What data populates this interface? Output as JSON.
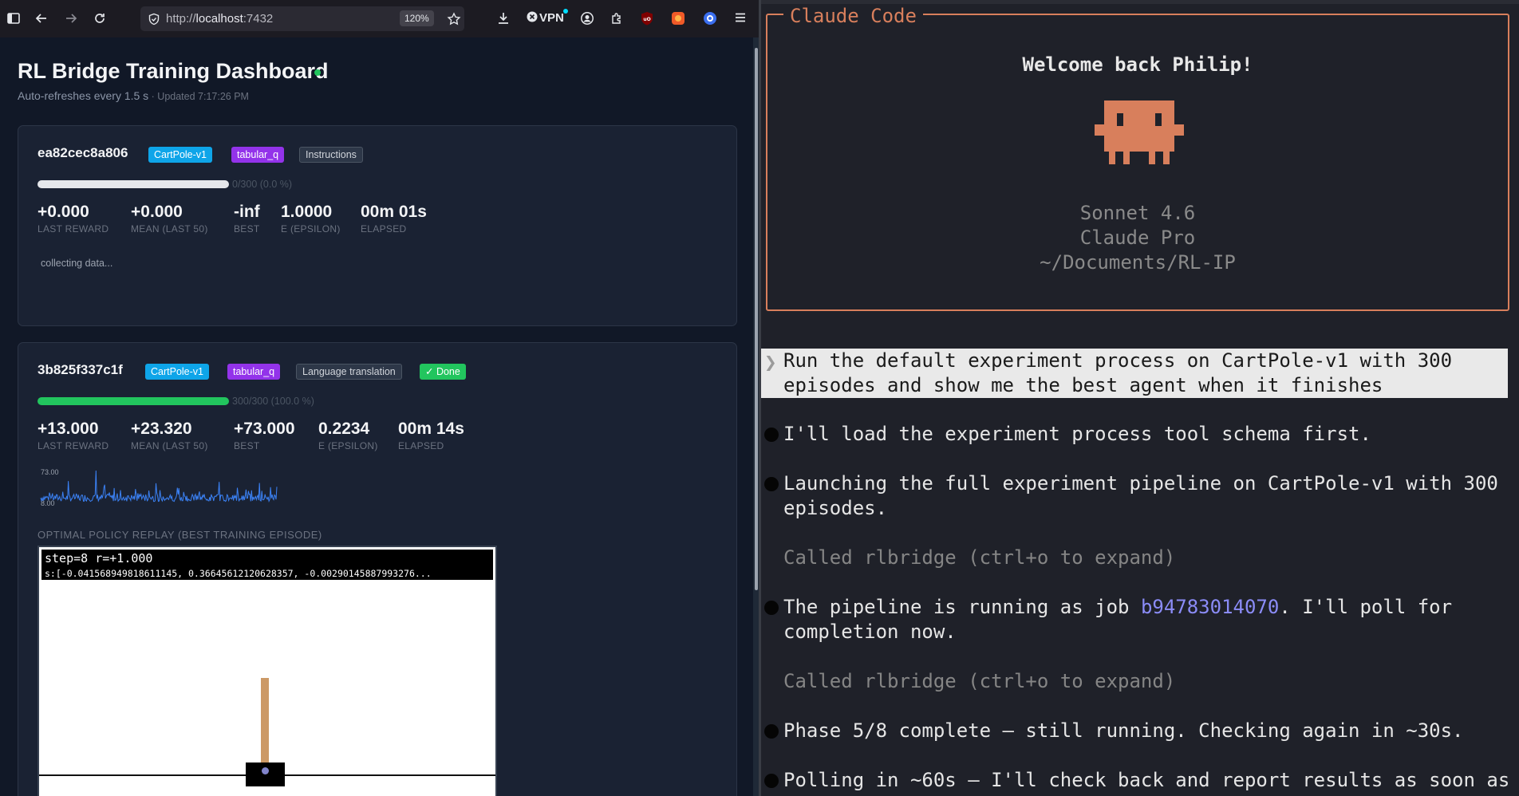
{
  "browser": {
    "url_scheme": "http://",
    "url_host": "localhost",
    "url_port": ":7432",
    "zoom": "120%",
    "vpn_label": "VPN"
  },
  "dashboard": {
    "title": "RL Bridge Training Dashboard",
    "refresh_text": "Auto-refreshes every 1.5 s",
    "separator": " · ",
    "updated_text": "Updated 7:17:26 PM",
    "runs": [
      {
        "id": "ea82cec8a806",
        "env": "CartPole-v1",
        "algo": "tabular_q",
        "tag": "Instructions",
        "progress_text": "0/300 (0.0 %)",
        "progress_fraction": 0.0,
        "stats": [
          {
            "value": "+0.000",
            "label": "LAST REWARD"
          },
          {
            "value": "+0.000",
            "label": "MEAN (LAST 50)"
          },
          {
            "value": "-inf",
            "label": "BEST"
          },
          {
            "value": "1.0000",
            "label": "Ε (EPSILON)"
          },
          {
            "value": "00m 01s",
            "label": "ELAPSED"
          }
        ],
        "status_text": "collecting data..."
      },
      {
        "id": "3b825f337c1f",
        "env": "CartPole-v1",
        "algo": "tabular_q",
        "tag": "Language translation",
        "status_badge": "✓ Done",
        "progress_text": "300/300 (100.0 %)",
        "progress_fraction": 1.0,
        "stats": [
          {
            "value": "+13.000",
            "label": "LAST REWARD"
          },
          {
            "value": "+23.320",
            "label": "MEAN (LAST 50)"
          },
          {
            "value": "+73.000",
            "label": "BEST"
          },
          {
            "value": "0.2234",
            "label": "Ε (EPSILON)"
          },
          {
            "value": "00m 14s",
            "label": "ELAPSED"
          }
        ],
        "sparkline": {
          "max_label": "73.00",
          "min_label": "8.00",
          "color": "#3b82f6"
        },
        "replay_title": "OPTIMAL POLICY REPLAY (BEST TRAINING EPISODE)",
        "replay_hud_line1": "step=8  r=+1.000",
        "replay_hud_line2": "s:[-0.041568949818611145, 0.36645612120628357, -0.00290145887993276..."
      }
    ]
  },
  "terminal": {
    "box_title": "Claude Code",
    "welcome": "Welcome back Philip!",
    "model": "Sonnet 4.6",
    "plan": "Claude Pro",
    "cwd": "~/Documents/RL-IP",
    "prompt_chevron": "❯",
    "prompt_line1": "Run the default experiment process on CartPole-v1 with 300",
    "prompt_line2": "episodes and show me the best agent when it finishes",
    "msg1": "I'll load the experiment process tool schema first.",
    "msg2_line1": "Launching the full experiment pipeline on CartPole-v1 with 300",
    "msg2_line2": "episodes.",
    "called1": "Called rlbridge (ctrl+o to expand)",
    "msg3_pre": "The pipeline is running as job ",
    "msg3_job": "b94783014070",
    "msg3_post": ". I'll poll for",
    "msg3_line2": "completion now.",
    "called2": "Called rlbridge (ctrl+o to expand)",
    "msg4": "Phase 5/8 complete — still running. Checking again in ~30s.",
    "msg5": "Polling in ~60s — I'll check back and report results as soon as"
  },
  "colors": {
    "accent_orange": "#d87f5c",
    "success_green": "#22c55e",
    "env_badge": "#0ea5e9",
    "algo_badge": "#9333ea",
    "link": "#8b8cf7"
  }
}
